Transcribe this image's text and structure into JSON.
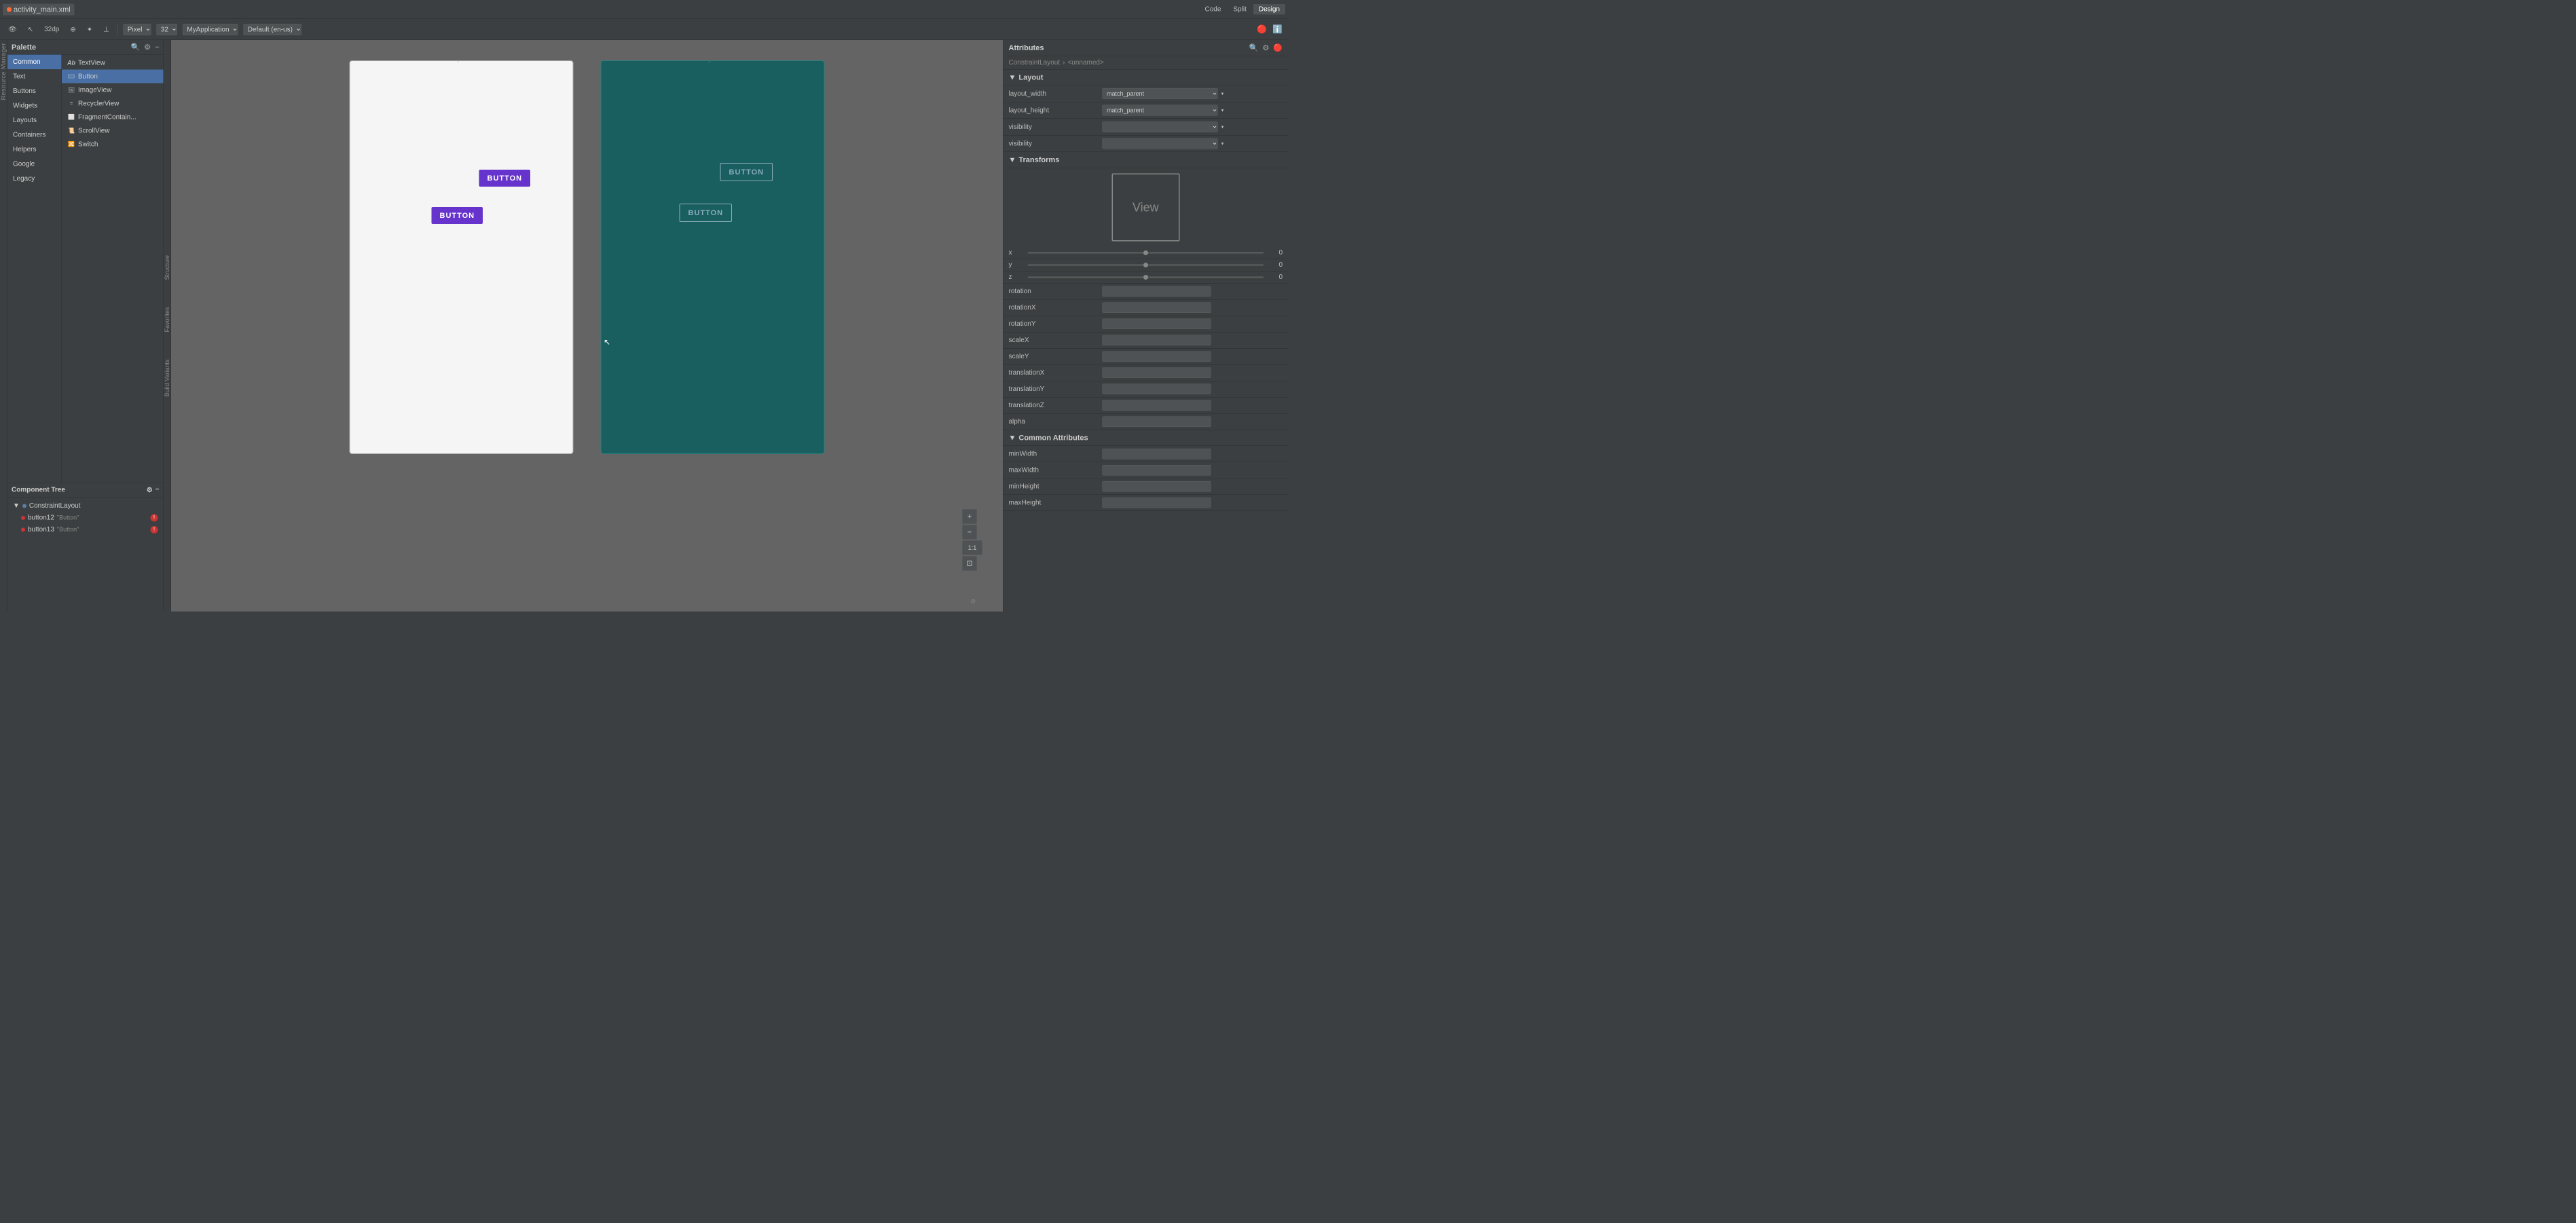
{
  "topBar": {
    "tab_label": "activity_main.xml",
    "dot_color": "#ff6b35"
  },
  "toolbar": {
    "code_label": "Code",
    "split_label": "Split",
    "design_label": "Design",
    "pixel_label": "Pixel",
    "zoom_value": "32",
    "app_name": "MyApplication",
    "locale": "Default (en-us)"
  },
  "palette": {
    "title": "Palette",
    "categories": [
      {
        "label": "Common",
        "active": true
      },
      {
        "label": "Text"
      },
      {
        "label": "Buttons"
      },
      {
        "label": "Widgets"
      },
      {
        "label": "Layouts"
      },
      {
        "label": "Containers"
      },
      {
        "label": "Helpers"
      },
      {
        "label": "Google"
      },
      {
        "label": "Legacy"
      }
    ],
    "widgets": [
      {
        "label": "TextView",
        "icon": "Ab"
      },
      {
        "label": "Button",
        "icon": "btn",
        "selected": true
      },
      {
        "label": "ImageView",
        "icon": "img"
      },
      {
        "label": "RecyclerView",
        "icon": "rv"
      },
      {
        "label": "FragmentContain...",
        "icon": "frag"
      },
      {
        "label": "ScrollView",
        "icon": "scroll"
      },
      {
        "label": "Switch",
        "icon": "sw"
      }
    ]
  },
  "componentTree": {
    "title": "Component Tree",
    "items": [
      {
        "label": "ConstraintLayout",
        "indent": 0,
        "icon": "layout"
      },
      {
        "label": "button12",
        "sublabel": "\"Button\"",
        "indent": 1,
        "hasError": true
      },
      {
        "label": "button13",
        "sublabel": "\"Button\"",
        "indent": 1,
        "hasError": true
      }
    ]
  },
  "canvas": {
    "button1_label": "BUTTON",
    "button2_label": "BUTTON",
    "button3_label": "BUTTON",
    "button4_label": "BUTTON",
    "pin_icon": "📌"
  },
  "attributes": {
    "title": "Attributes",
    "breadcrumb_type": "ConstraintLayout",
    "breadcrumb_name": "<unnamed>",
    "sections": {
      "layout": {
        "title": "Layout",
        "expanded": true,
        "rows": [
          {
            "label": "layout_width",
            "value": "match_parent"
          },
          {
            "label": "layout_height",
            "value": "match_parent"
          },
          {
            "label": "visibility",
            "value": ""
          },
          {
            "label": "visibility",
            "value": ""
          }
        ]
      },
      "transforms": {
        "title": "Transforms",
        "expanded": true,
        "preview_text": "View",
        "rotation_axes": [
          {
            "axis": "x",
            "value": "0"
          },
          {
            "axis": "y",
            "value": "0"
          },
          {
            "axis": "z",
            "value": "0"
          }
        ],
        "rows": [
          {
            "label": "rotation",
            "value": ""
          },
          {
            "label": "rotationX",
            "value": ""
          },
          {
            "label": "rotationY",
            "value": ""
          },
          {
            "label": "scaleX",
            "value": ""
          },
          {
            "label": "scaleY",
            "value": ""
          },
          {
            "label": "translationX",
            "value": ""
          },
          {
            "label": "translationY",
            "value": ""
          },
          {
            "label": "translationZ",
            "value": ""
          },
          {
            "label": "alpha",
            "value": ""
          }
        ]
      },
      "common": {
        "title": "Common Attributes",
        "expanded": true,
        "rows": [
          {
            "label": "minWidth",
            "value": ""
          },
          {
            "label": "maxWidth",
            "value": ""
          },
          {
            "label": "minHeight",
            "value": ""
          },
          {
            "label": "maxHeight",
            "value": ""
          }
        ]
      }
    }
  },
  "leftTabs": {
    "structure_label": "Structure",
    "favorites_label": "Favorites",
    "build_label": "Build Variants"
  },
  "canvasZoom": {
    "plus": "+",
    "minus": "−",
    "ratio": "1:1"
  }
}
